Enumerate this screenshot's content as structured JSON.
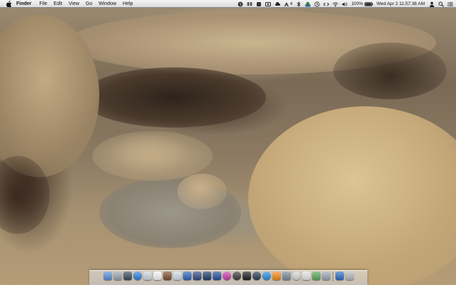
{
  "menubar": {
    "app_name": "Finder",
    "menus": [
      "File",
      "Edit",
      "View",
      "Go",
      "Window",
      "Help"
    ],
    "status": {
      "badge_number": "4",
      "battery_percent": "100%",
      "date_time": "Wed Apr 2  11:57:38 AM"
    }
  },
  "dock": {
    "apps": [
      {
        "name": "finder-icon",
        "color": "#5b8fd6"
      },
      {
        "name": "launchpad-icon",
        "color": "#9aa3ad"
      },
      {
        "name": "mission-control-icon",
        "color": "#3c4a5e"
      },
      {
        "name": "safari-icon",
        "color": "#2f7fd8"
      },
      {
        "name": "mail-icon",
        "color": "#cfd6df"
      },
      {
        "name": "calendar-icon",
        "color": "#f4f4f4"
      },
      {
        "name": "photos-icon",
        "color": "#7c4d2f"
      },
      {
        "name": "preview-icon",
        "color": "#d0dbe6"
      },
      {
        "name": "xcode-icon",
        "color": "#2a66b8"
      },
      {
        "name": "notes-icon",
        "color": "#304a80"
      },
      {
        "name": "photo-booth-icon",
        "color": "#1e3c6e"
      },
      {
        "name": "iphoto-icon",
        "color": "#26509a"
      },
      {
        "name": "itunes-icon",
        "color": "#c83cb0"
      },
      {
        "name": "dvd-player-icon",
        "color": "#3b3b3b"
      },
      {
        "name": "terminal-icon",
        "color": "#1d1d1d"
      },
      {
        "name": "quicktime-icon",
        "color": "#2c3d55"
      },
      {
        "name": "app-store-icon",
        "color": "#2a8be0"
      },
      {
        "name": "ibooks-icon",
        "color": "#f08a1a"
      },
      {
        "name": "system-preferences-icon",
        "color": "#7c8a99"
      },
      {
        "name": "compass-icon",
        "color": "#d8d8d8"
      },
      {
        "name": "dictionary-icon",
        "color": "#e4e4e4"
      },
      {
        "name": "maps-icon",
        "color": "#5aa85a"
      },
      {
        "name": "disk-utility-icon",
        "color": "#9aa7b4"
      },
      {
        "name": "downloads-stack-icon",
        "color": "#2b6fc4"
      },
      {
        "name": "trash-icon",
        "color": "#b5b9bd"
      }
    ]
  }
}
